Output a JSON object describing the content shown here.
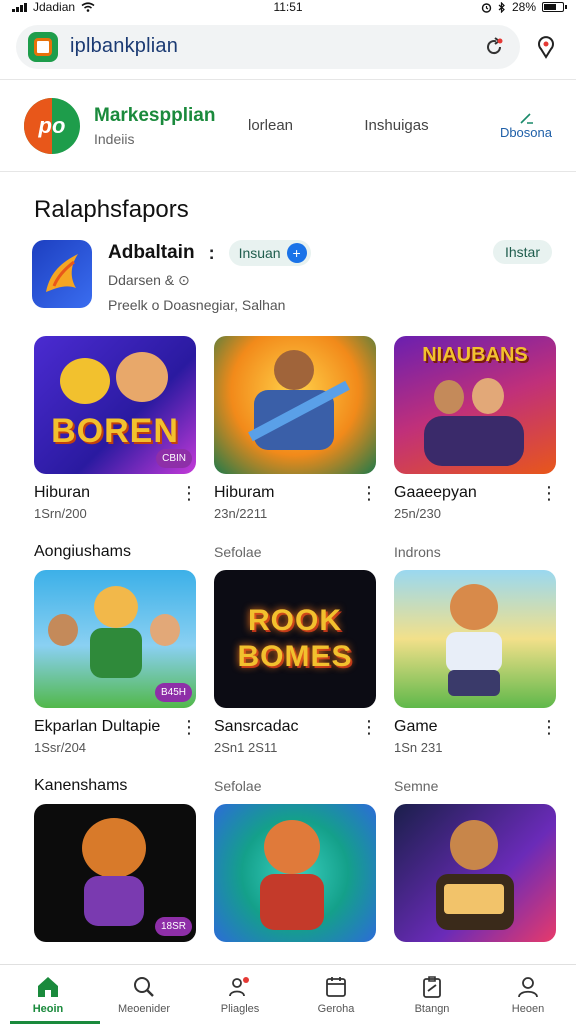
{
  "status_bar": {
    "carrier": "Jdadian",
    "time": "11:51",
    "battery": "28%"
  },
  "browser": {
    "url": "iplbankplian"
  },
  "store": {
    "name": "Markespplian",
    "subtitle": "Indeiis",
    "nav": [
      "lorlean",
      "Inshuigas",
      "Dbosona"
    ]
  },
  "section": {
    "title": "Ralaphsfapors"
  },
  "featured_app": {
    "title": "Adbaltain",
    "chip_label": "Insuan",
    "developer": "Ddarsen & ⊙",
    "description": "Preelk o Doasnegiar, Salhan",
    "install_label": "Ihstar"
  },
  "rows": [
    {
      "label_row": [
        "Aongiushams",
        "Sefolae",
        "Indrons"
      ],
      "tiles": [
        {
          "art": "BOREN",
          "badge": "CBIN",
          "name": "Hiburan",
          "sub": "1Srn/200",
          "color_a": "#4b2bd1",
          "color_b": "#f2a21b"
        },
        {
          "art": "",
          "badge": "",
          "name": "Hiburam",
          "sub": "23n/2211",
          "color_a": "#f28a1a",
          "color_b": "#2a8a5b"
        },
        {
          "art": "NIAUBANS",
          "badge": "",
          "name": "Gaaeepyan",
          "sub": "25n/230",
          "color_a": "#6a1fb0",
          "color_b": "#e8571a"
        }
      ]
    },
    {
      "label_row": [],
      "tiles": [
        {
          "art": "",
          "badge": "B45H",
          "name": "Ekparlan Dultapie",
          "sub": "1Ssr/204",
          "color_a": "#3cb0e8",
          "color_b": "#52b84a"
        },
        {
          "art": "ROOK BOMES",
          "badge": "",
          "name": "Sansrcadac",
          "sub": "2Sn1 2S11",
          "color_a": "#0a0a12",
          "color_b": "#1f1636"
        },
        {
          "art": "",
          "badge": "",
          "name": "Game",
          "sub": "1Sn 231",
          "color_a": "#5fb84a",
          "color_b": "#f2c12e"
        }
      ]
    },
    {
      "label_row": [
        "Kanenshams",
        "Sefolae",
        "Semne"
      ],
      "tiles": [
        {
          "art": "",
          "badge": "18SR",
          "name": "",
          "sub": "",
          "color_a": "#0c0c0c",
          "color_b": "#1a1a1a"
        },
        {
          "art": "",
          "badge": "",
          "name": "",
          "sub": "",
          "color_a": "#14a08a",
          "color_b": "#2c6cd8"
        },
        {
          "art": "",
          "badge": "",
          "name": "",
          "sub": "",
          "color_a": "#1a1f4a",
          "color_b": "#6a2bb8"
        }
      ]
    }
  ],
  "bottom_nav": [
    {
      "label": "Heoin",
      "icon": "home-icon",
      "active": true
    },
    {
      "label": "Meoenider",
      "icon": "search-icon",
      "active": false
    },
    {
      "label": "Pliagles",
      "icon": "people-icon",
      "active": false
    },
    {
      "label": "Geroha",
      "icon": "calendar-icon",
      "active": false
    },
    {
      "label": "Btangn",
      "icon": "clipboard-icon",
      "active": false
    },
    {
      "label": "Heoen",
      "icon": "person-icon",
      "active": false
    }
  ],
  "colors": {
    "brand_green": "#1a8a3c",
    "accent_blue": "#1a73e8",
    "install_chip_bg": "#e8f2f0"
  }
}
